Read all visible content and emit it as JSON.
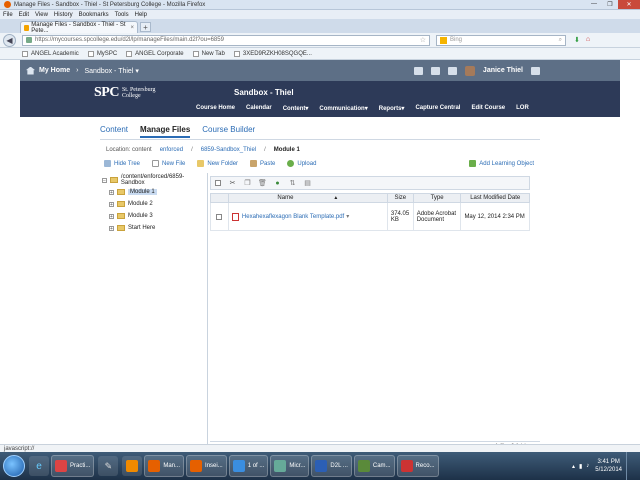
{
  "window": {
    "title": "Manage Files - Sandbox - Thiel - St Petersburg College - Mozilla Firefox",
    "minimize": "—",
    "maximize": "❐",
    "close": "✕"
  },
  "menu": [
    "File",
    "Edit",
    "View",
    "History",
    "Bookmarks",
    "Tools",
    "Help"
  ],
  "tab": {
    "label": "Manage Files - Sandbox - Thiel - St Pete...",
    "close": "×",
    "new_tab": "+"
  },
  "nav": {
    "back": "◀",
    "url": "https://mycourses.spcollege.edu/d2l/lp/manageFiles/main.d2l?ou=6859",
    "search_placeholder": "Bing"
  },
  "bookmarks": [
    "ANGEL Academic",
    "MySPC",
    "ANGEL Corporate",
    "New Tab",
    "3XED9RZKH08SQGQE..."
  ],
  "angel": {
    "home": "My Home",
    "crumb_sep": "›",
    "crumb": "Sandbox - Thiel",
    "crumb_caret": "▾",
    "user": "Janice Thiel"
  },
  "header": {
    "logo_big": "SPC",
    "logo_line1": "St. Petersburg",
    "logo_line2": "College",
    "course_title": "Sandbox - Thiel",
    "nav": [
      "Course Home",
      "Calendar",
      "Content▾",
      "Communication▾",
      "Reports▾",
      "Capture Central",
      "Edit Course",
      "LOR"
    ]
  },
  "tabs": [
    "Content",
    "Manage Files",
    "Course Builder"
  ],
  "location": {
    "label": "Location: content",
    "part1": "enforced",
    "sep": "/",
    "part2": "6859-Sandbox_Thiel",
    "current": "Module 1"
  },
  "toolbar": {
    "hide_tree": "Hide Tree",
    "new_file": "New File",
    "new_folder": "New Folder",
    "paste": "Paste",
    "upload": "Upload",
    "add_learning_object": "Add Learning Object"
  },
  "tree": {
    "root": "/content/enforced/6859-Sandbox",
    "items": [
      "Module 1",
      "Module 2",
      "Module 3",
      "Start Here"
    ],
    "expander": "+",
    "root_expander": "−"
  },
  "grid": {
    "columns": {
      "name": "Name",
      "size": "Size",
      "type": "Type",
      "modified": "Last Modified Date"
    },
    "sort_arrow": "▲",
    "rows": [
      {
        "name": "Hexahexaflexagon Blank Template.pdf",
        "size": "374.05 KB",
        "type": "Adobe Acrobat Document",
        "modified": "May 12, 2014 2:34 PM"
      }
    ],
    "summary": "1 file, 0 folders"
  },
  "status": "javascript://",
  "taskbar": {
    "tasks": [
      "Practi...",
      "Man...",
      "Insei...",
      "1 of ...",
      "Micr...",
      "D2L ...",
      "Cam...",
      "Reco..."
    ],
    "time": "3:41 PM",
    "date": "5/12/2014"
  },
  "colors": {
    "angel_nav": "#5d6f86",
    "spc_header": "#2d3a58",
    "link": "#2b6cb5"
  }
}
